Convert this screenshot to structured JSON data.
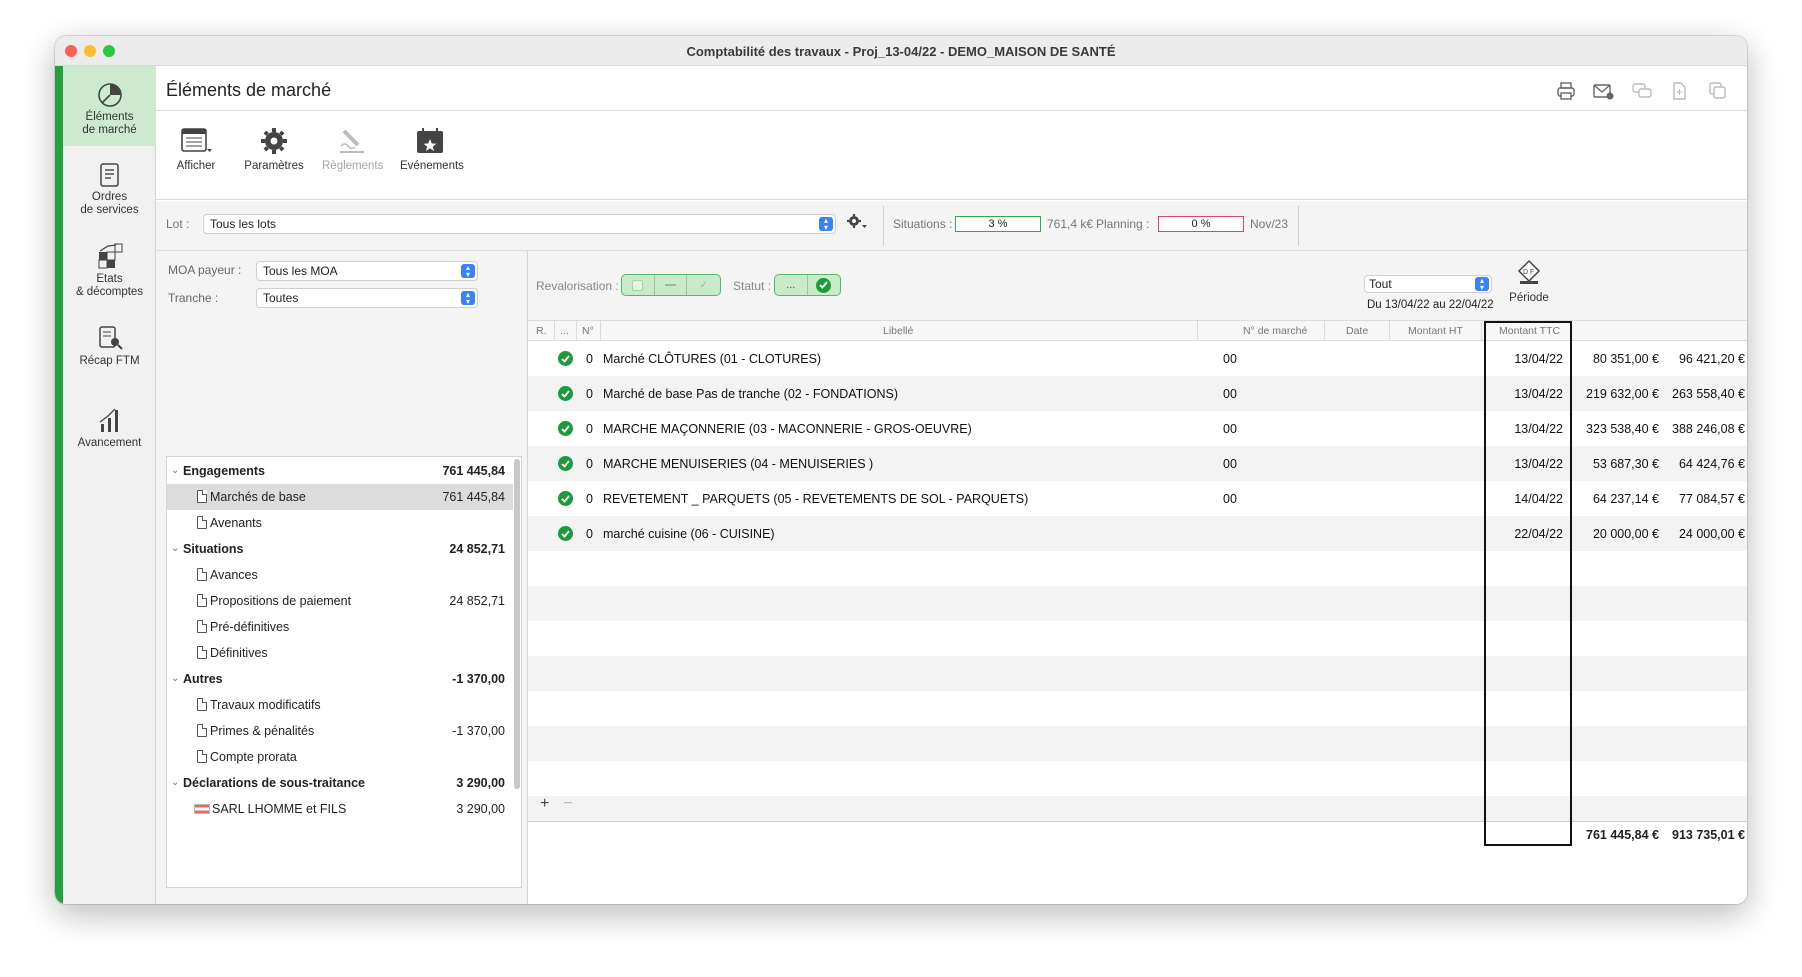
{
  "window": {
    "title": "Comptabilité des travaux - Proj_13-04/22 - DEMO_MAISON DE SANTÉ"
  },
  "sidebar": {
    "items": [
      {
        "line1": "Éléments",
        "line2": "de marché"
      },
      {
        "line1": "Ordres",
        "line2": "de services"
      },
      {
        "line1": "Etats",
        "line2": "& décomptes"
      },
      {
        "line1": "Récap FTM",
        "line2": ""
      },
      {
        "line1": "Avancement",
        "line2": ""
      }
    ]
  },
  "page": {
    "title": "Éléments de marché"
  },
  "toolbar": {
    "afficher": "Afficher",
    "parametres": "Paramètres",
    "reglements": "Règlements",
    "evenements": "Evénements"
  },
  "lot": {
    "label": "Lot :",
    "value": "Tous les lots",
    "situations_label": "Situations :",
    "situations_value": "3 %",
    "situations_progress": 0.03,
    "amount": "761,4 k€",
    "planning_label": "Planning :",
    "planning_value": "0 %",
    "planning_progress": 0,
    "end_date": "Nov/23"
  },
  "filters": {
    "moa_label": "MOA payeur :",
    "moa_value": "Tous les MOA",
    "tranche_label": "Tranche :",
    "tranche_value": "Toutes",
    "revalorisation_label": "Revalorisation :",
    "statut_label": "Statut :",
    "statut_dots": "...",
    "period_select": "Tout",
    "period_range": "Du 13/04/22 au 22/04/22",
    "period_label": "Période"
  },
  "tree": {
    "engagements": {
      "label": "Engagements",
      "value": "761 445,84"
    },
    "marches_base": {
      "label": "Marchés de base",
      "value": "761 445,84"
    },
    "avenants": {
      "label": "Avenants",
      "value": ""
    },
    "situations": {
      "label": "Situations",
      "value": "24 852,71"
    },
    "avances": {
      "label": "Avances",
      "value": ""
    },
    "propositions": {
      "label": "Propositions de paiement",
      "value": "24 852,71"
    },
    "pre_definitives": {
      "label": "Pré-définitives",
      "value": ""
    },
    "definitives": {
      "label": "Définitives",
      "value": ""
    },
    "autres": {
      "label": "Autres",
      "value": "-1 370,00"
    },
    "travaux_modif": {
      "label": "Travaux modificatifs",
      "value": ""
    },
    "primes": {
      "label": "Primes & pénalités",
      "value": "-1 370,00"
    },
    "compte_prorata": {
      "label": "Compte prorata",
      "value": ""
    },
    "declarations": {
      "label": "Déclarations de sous-traitance",
      "value": "3 290,00"
    },
    "sarl": {
      "label": "SARL LHOMME et FILS",
      "value": "3 290,00"
    }
  },
  "table": {
    "headers": {
      "r": "R.",
      "dots": "...",
      "n": "N°",
      "libelle": "Libellé",
      "nmarche": "N° de marché",
      "date": "Date",
      "ht": "Montant HT",
      "ttc": "Montant TTC"
    },
    "rows": [
      {
        "n": "0",
        "libelle": "Marché CLÔTURES (01 - CLOTURES)",
        "nmarche": "00",
        "date": "13/04/22",
        "ht": "80 351,00 €",
        "ttc": "96 421,20 €"
      },
      {
        "n": "0",
        "libelle": "Marché de base Pas de tranche (02 - FONDATIONS)",
        "nmarche": "00",
        "date": "13/04/22",
        "ht": "219 632,00 €",
        "ttc": "263 558,40 €"
      },
      {
        "n": "0",
        "libelle": "MARCHE MAÇONNERIE (03 - MACONNERIE - GROS-OEUVRE)",
        "nmarche": "00",
        "date": "13/04/22",
        "ht": "323 538,40 €",
        "ttc": "388 246,08 €"
      },
      {
        "n": "0",
        "libelle": "MARCHE MENUISERIES (04 - MENUISERIES )",
        "nmarche": "00",
        "date": "13/04/22",
        "ht": "53 687,30 €",
        "ttc": "64 424,76 €"
      },
      {
        "n": "0",
        "libelle": "REVETEMENT _ PARQUETS (05 - REVETEMENTS DE SOL - PARQUETS)",
        "nmarche": "00",
        "date": "14/04/22",
        "ht": "64 237,14 €",
        "ttc": "77 084,57 €"
      },
      {
        "n": "0",
        "libelle": "marché cuisine (06 - CUISINE)",
        "nmarche": "",
        "date": "22/04/22",
        "ht": "20 000,00 €",
        "ttc": "24 000,00 €"
      }
    ],
    "total_ht": "761 445,84 €",
    "total_ttc": "913 735,01 €"
  },
  "footer": {
    "add": "+",
    "remove": "−"
  }
}
